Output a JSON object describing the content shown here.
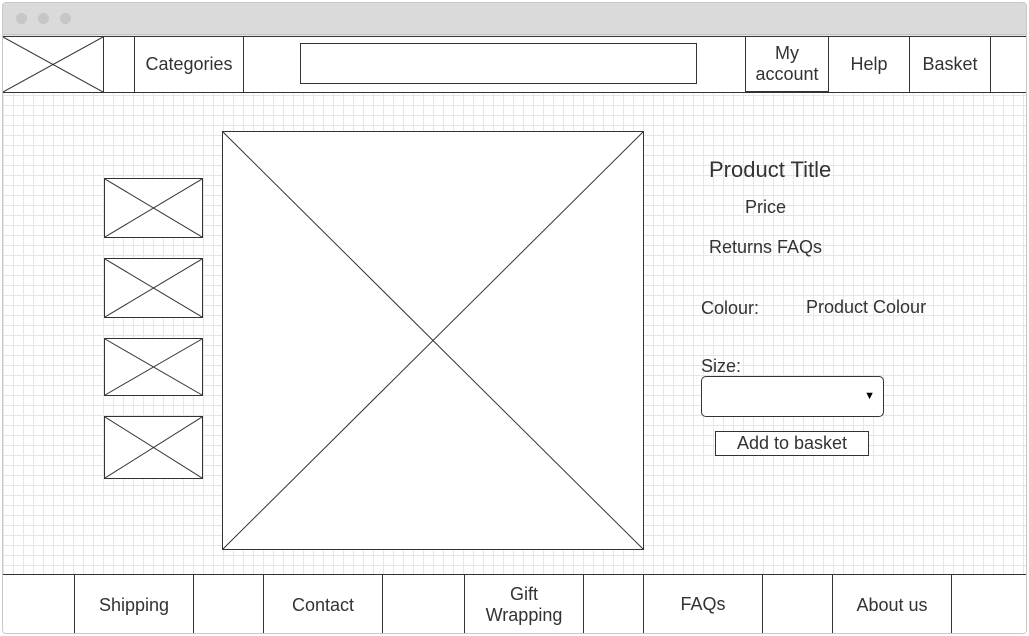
{
  "header": {
    "logo_icon": "image-placeholder-icon",
    "categories_label": "Categories",
    "search_value": "",
    "my_account_label": "My account",
    "help_label": "Help",
    "basket_label": "Basket"
  },
  "product": {
    "thumbnail_icon": "image-placeholder-icon",
    "main_image_icon": "image-placeholder-icon",
    "title": "Product Title",
    "price": "Price",
    "returns_faqs": "Returns FAQs",
    "colour_label": "Colour:",
    "colour_value": "Product Colour",
    "size_label": "Size:",
    "size_selected": "",
    "add_to_basket_label": "Add to basket"
  },
  "footer": {
    "links": [
      "Shipping",
      "Contact",
      "Gift Wrapping",
      "FAQs",
      "About us"
    ]
  }
}
